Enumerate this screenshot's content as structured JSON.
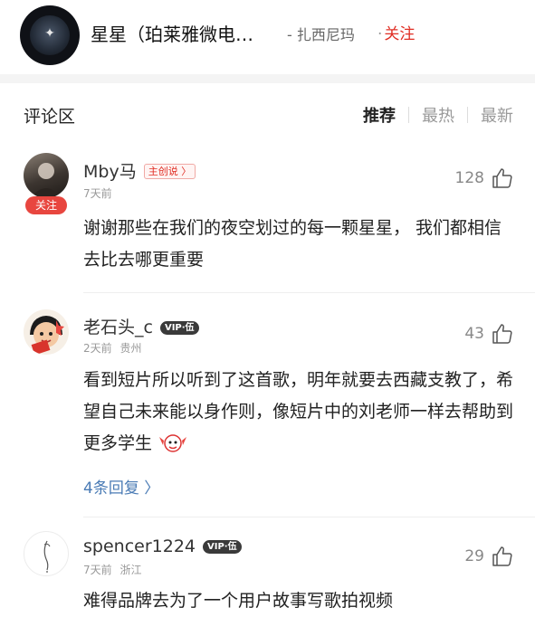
{
  "header": {
    "title": "星星（珀莱雅微电…",
    "author": "- 扎西尼玛",
    "follow_dot": "·",
    "follow": "关注"
  },
  "section": {
    "title": "评论区",
    "sort_tabs": [
      "推荐",
      "最热",
      "最新"
    ],
    "active_tab": "推荐"
  },
  "comments": [
    {
      "username": "Mby马",
      "badge": "主创说 〉",
      "time": "7天前",
      "location": "",
      "likes": "128",
      "follow_label": "关注",
      "content": "谢谢那些在我们的夜空划过的每一颗星星， 我们都相信去比去哪更重要",
      "replies": ""
    },
    {
      "username": "老石头_c",
      "badge": "VIP·伍",
      "time": "2天前",
      "location": "贵州",
      "likes": "43",
      "content": "看到短片所以听到了这首歌，明年就要去西藏支教了，希望自己未来能以身作则，像短片中的刘老师一样去帮助到更多学生",
      "replies": "4条回复 〉"
    },
    {
      "username": "spencer1224",
      "badge": "VIP·伍",
      "time": "7天前",
      "location": "浙江",
      "likes": "29",
      "content": "难得品牌去为了一个用户故事写歌拍视频",
      "replies": ""
    }
  ],
  "colors": {
    "accent_red": "#e02e24",
    "link_blue": "#4a7bb5",
    "meta_gray": "#999999"
  }
}
